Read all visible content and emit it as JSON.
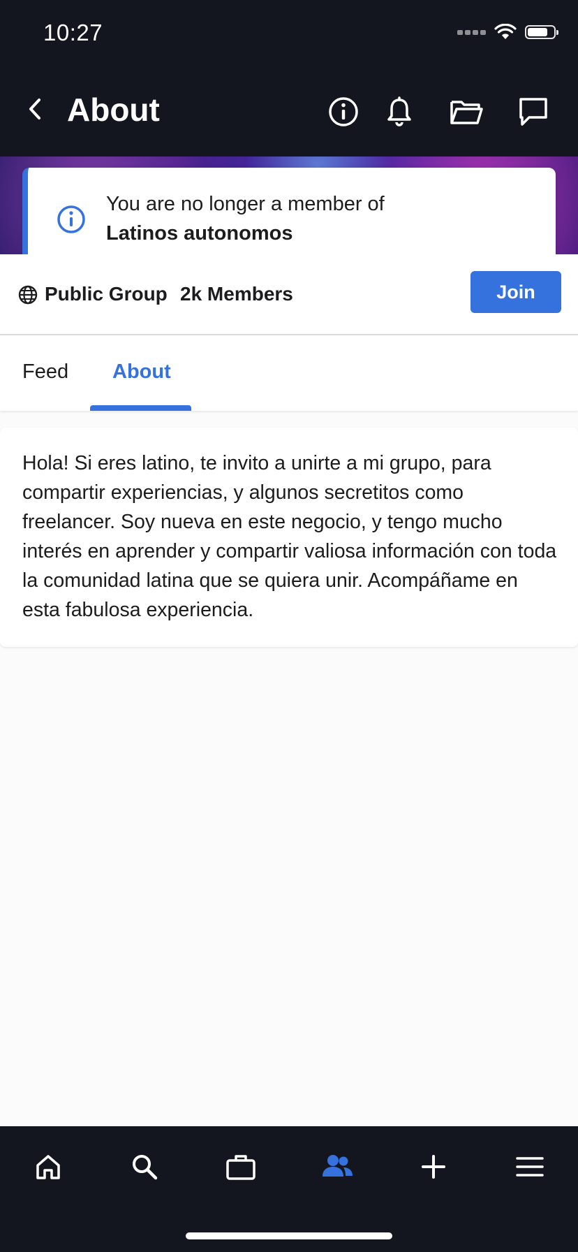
{
  "status_bar": {
    "time": "10:27"
  },
  "nav": {
    "title": "About"
  },
  "toast": {
    "message": "You are no longer a member of",
    "group_name": "Latinos autonomos"
  },
  "group_info": {
    "privacy": "Public Group",
    "members": "2k Members",
    "join_label": "Join"
  },
  "tabs": [
    {
      "label": "Feed",
      "active": false
    },
    {
      "label": "About",
      "active": true
    }
  ],
  "about": {
    "description": "Hola! Si eres latino, te invito a unirte a mi grupo, para compartir experiencias, y algunos secretitos como freelancer. Soy nueva en este negocio, y tengo mucho interés en aprender y compartir valiosa información con toda la comunidad latina que se quiera unir. Acompáñame en esta fabulosa experiencia."
  },
  "bottom_nav": [
    {
      "icon": "home-icon",
      "active": false
    },
    {
      "icon": "search-icon",
      "active": false
    },
    {
      "icon": "briefcase-icon",
      "active": false
    },
    {
      "icon": "groups-icon",
      "active": true
    },
    {
      "icon": "plus-icon",
      "active": false
    },
    {
      "icon": "menu-icon",
      "active": false
    }
  ],
  "colors": {
    "accent": "#3672dd",
    "dark_bar": "#14161f",
    "background": "#fbfbfb"
  }
}
